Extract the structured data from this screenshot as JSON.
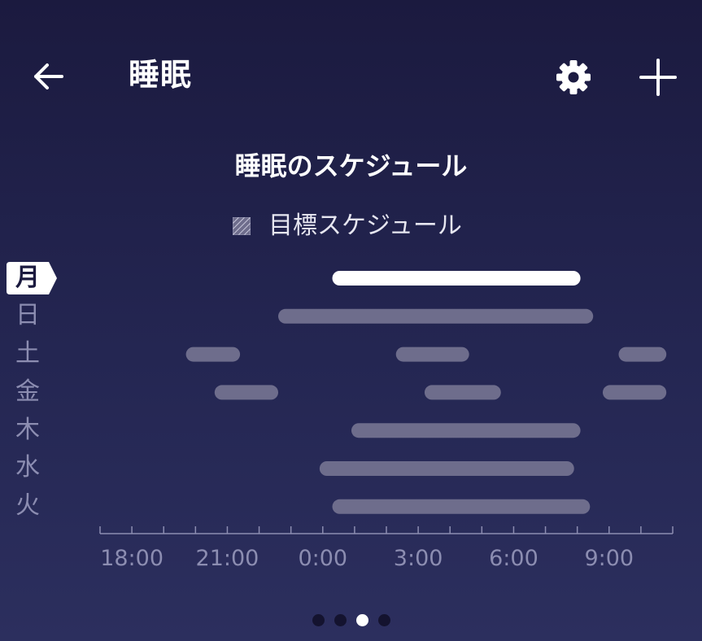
{
  "header": {
    "title": "睡眠",
    "back_icon": "arrow-left-icon",
    "settings_icon": "gear-icon",
    "add_icon": "plus-icon"
  },
  "schedule": {
    "title": "睡眠のスケジュール",
    "legend_label": "目標スケジュール",
    "days": [
      "月",
      "日",
      "土",
      "金",
      "木",
      "水",
      "火"
    ],
    "current_day_index": 0
  },
  "colors": {
    "bar_current": "#ffffff",
    "bar_other": "#6e6d8c",
    "axis": "#8c8db1",
    "background_top": "#1b1a3f",
    "background_bottom": "#2c2f5e"
  },
  "chart_data": {
    "type": "range-bar",
    "categories": [
      "月",
      "日",
      "土",
      "金",
      "木",
      "水",
      "火"
    ],
    "x_tick_labels": [
      "18:00",
      "21:00",
      "0:00",
      "3:00",
      "6:00",
      "9:00"
    ],
    "x_ticks_hours": [
      18,
      21,
      24,
      27,
      30,
      33
    ],
    "xlim_hours": [
      17,
      35
    ],
    "minor_tick_step_hours": 1,
    "note_hours": "hours since 0:00 of the previous day; values above 24 are the next morning",
    "series": [
      {
        "day": "月",
        "segments": [
          [
            24.3,
            32.1
          ]
        ],
        "highlight": true
      },
      {
        "day": "日",
        "segments": [
          [
            22.6,
            32.5
          ]
        ]
      },
      {
        "day": "土",
        "segments": [
          [
            19.7,
            21.4
          ],
          [
            26.3,
            28.6
          ],
          [
            33.3,
            34.8
          ]
        ]
      },
      {
        "day": "金",
        "segments": [
          [
            20.6,
            22.6
          ],
          [
            27.2,
            29.6
          ],
          [
            32.8,
            34.8
          ]
        ]
      },
      {
        "day": "木",
        "segments": [
          [
            24.9,
            32.1
          ]
        ]
      },
      {
        "day": "水",
        "segments": [
          [
            23.9,
            31.9
          ]
        ]
      },
      {
        "day": "火",
        "segments": [
          [
            24.3,
            32.4
          ]
        ]
      }
    ]
  },
  "pager": {
    "count": 4,
    "active_index": 2
  }
}
